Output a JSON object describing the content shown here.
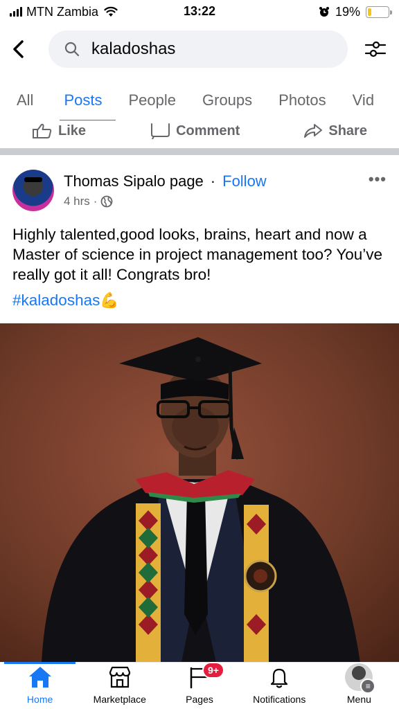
{
  "status_bar": {
    "carrier": "MTN Zambia",
    "time": "13:22",
    "battery": "19%",
    "battery_level": 0.19
  },
  "search": {
    "query": "kaladoshas"
  },
  "tabs": [
    {
      "label": "All"
    },
    {
      "label": "Posts"
    },
    {
      "label": "People"
    },
    {
      "label": "Groups"
    },
    {
      "label": "Photos"
    },
    {
      "label": "Vid"
    }
  ],
  "active_tab": "Posts",
  "action_bar": {
    "like": "Like",
    "comment": "Comment",
    "share": "Share"
  },
  "post": {
    "author": "Thomas Sipalo page",
    "separator": "·",
    "follow": "Follow",
    "time": "4 hrs",
    "meta_separator": "·",
    "more": "•••",
    "text": "Highly talented,good looks, brains, heart and now a Master of science in project management too? You’ve really got it all! Congrats bro!",
    "hashtag": "#kaladoshas",
    "emoji": "💪"
  },
  "bottom_nav": [
    {
      "label": "Home",
      "icon": "home-icon",
      "active": true
    },
    {
      "label": "Marketplace",
      "icon": "marketplace-icon"
    },
    {
      "label": "Pages",
      "icon": "pages-icon",
      "badge": "9+"
    },
    {
      "label": "Notifications",
      "icon": "bell-icon"
    },
    {
      "label": "Menu",
      "icon": "menu-avatar"
    }
  ],
  "colors": {
    "accent": "#1877f2",
    "badge": "#e41e3f",
    "photo_background": "#6b3826"
  }
}
